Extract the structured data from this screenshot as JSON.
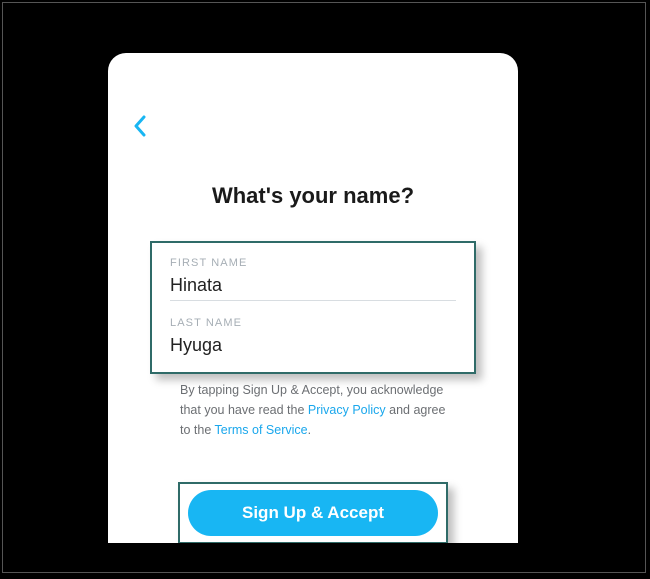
{
  "colors": {
    "accent": "#18b6f3",
    "highlight_frame": "#2f6b68"
  },
  "heading": "What's your name?",
  "fields": {
    "first_name": {
      "label": "FIRST NAME",
      "value": "Hinata"
    },
    "last_name": {
      "label": "LAST NAME",
      "value": "Hyuga"
    }
  },
  "legal": {
    "pre": "By tapping Sign Up & Accept, you acknowledge that you have read the ",
    "link1": "Privacy Policy",
    "mid": " and agree to the ",
    "link2": "Terms of Service",
    "period": "."
  },
  "cta_label": "Sign Up & Accept"
}
